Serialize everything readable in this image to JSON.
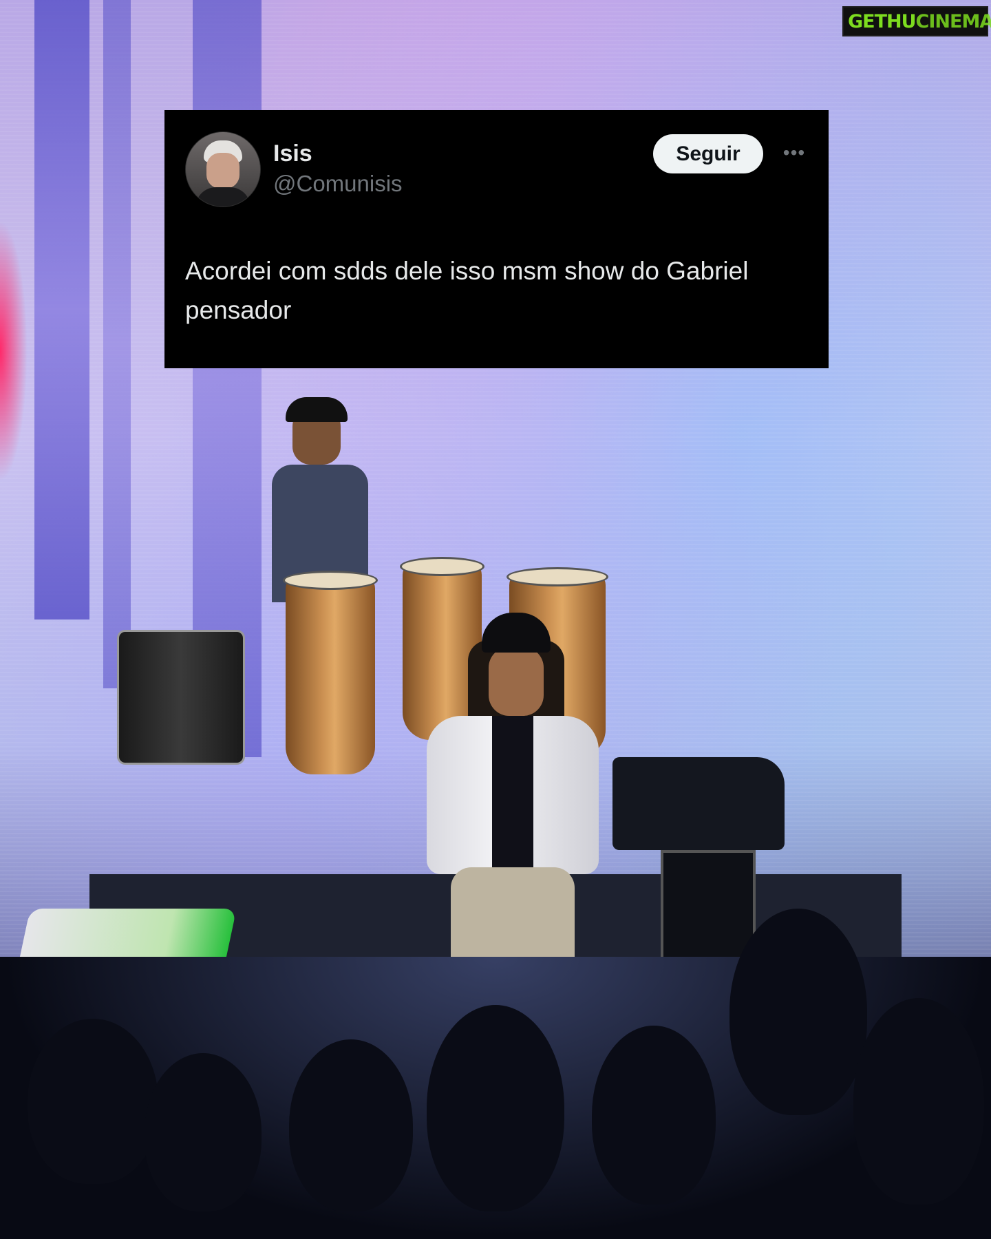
{
  "tweet": {
    "author_name": "Isis",
    "author_handle": "@Comunisis",
    "follow_label": "Seguir",
    "more_icon": "more-horizontal-icon",
    "text": "Acordei com sdds dele isso msm show do Gabriel pensador"
  },
  "watermark": {
    "part1": "GETHU",
    "part2": "CINEMA"
  },
  "colors": {
    "card_bg": "#000000",
    "name_text": "#e7e9ea",
    "handle_text": "#71767b",
    "follow_button_bg": "#eff3f4",
    "watermark_green": "#7ddc1f"
  }
}
